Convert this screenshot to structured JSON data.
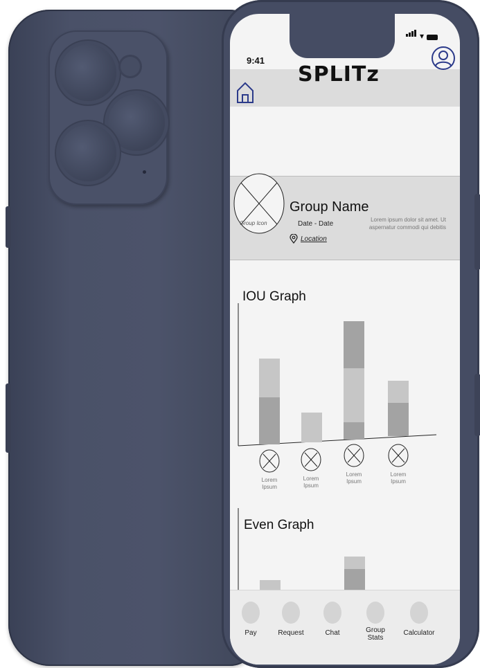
{
  "status_bar": {
    "time": "9:41"
  },
  "app": {
    "title": "SPLITz"
  },
  "group": {
    "icon_label": "Group Icon",
    "name": "Group Name",
    "date": "Date - Date",
    "location": "Location",
    "description": "Lorem ipsum dolor sit amet. Ut aspernatur commodi qui debitis"
  },
  "iou_graph": {
    "title": "IOU Graph"
  },
  "members": [
    {
      "label": "Lorem\nIpsum"
    },
    {
      "label": "Lorem\nIpsum"
    },
    {
      "label": "Lorem\nIpsum"
    },
    {
      "label": "Lorem\nIpsum"
    }
  ],
  "even_graph": {
    "title": "Even Graph"
  },
  "tabs": [
    {
      "label": "Pay"
    },
    {
      "label": "Request"
    },
    {
      "label": "Chat"
    },
    {
      "label": "Group\nStats"
    },
    {
      "label": "Calculator"
    }
  ],
  "colors": {
    "phone_body": "#454c63",
    "header_bg": "#dcdcdc",
    "bar_dark": "#a3a3a3",
    "bar_light": "#c6c6c6"
  }
}
